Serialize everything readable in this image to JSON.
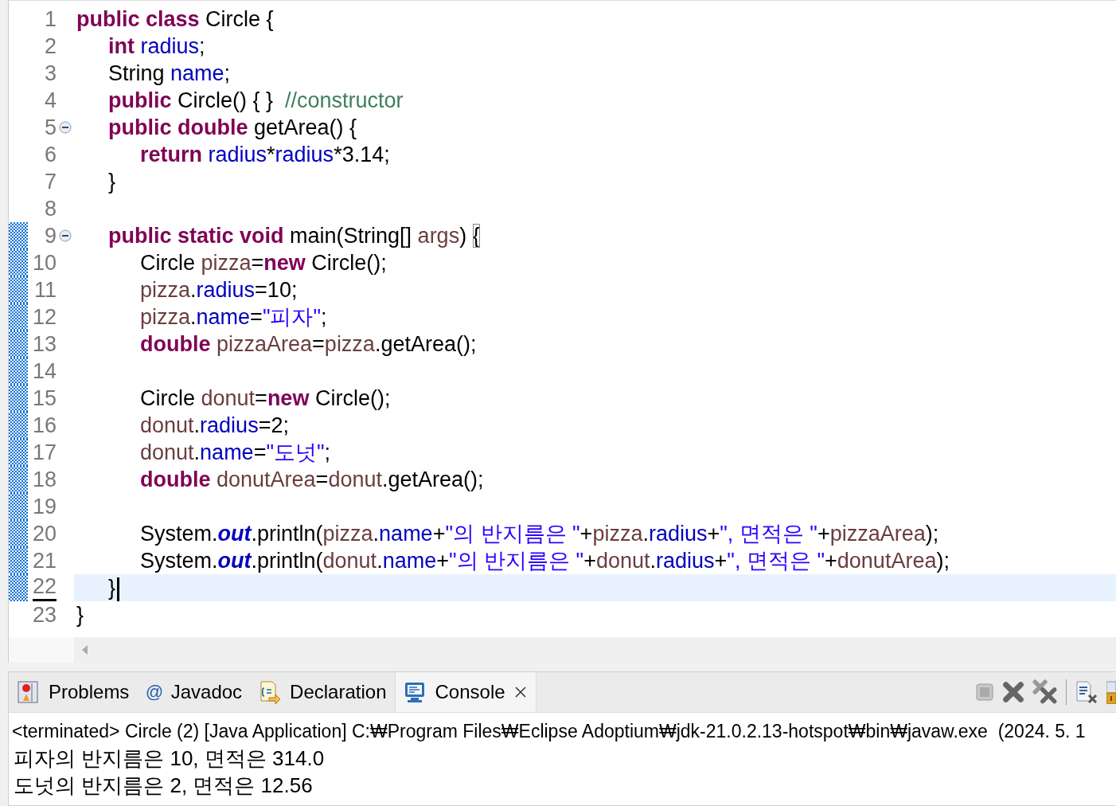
{
  "editor": {
    "lines": [
      {
        "number": "1",
        "changed": false,
        "current": false,
        "tokens": [
          {
            "kind": "kw",
            "text": "public class"
          },
          {
            "kind": "plain",
            "text": " Circle {"
          }
        ],
        "children": [
          {
            "number": "2",
            "changed": false,
            "current": false,
            "tokens": [
              {
                "kind": "kw",
                "text": "int"
              },
              {
                "kind": "field",
                "text": " radius"
              },
              {
                "kind": "plain",
                "text": ";"
              }
            ]
          },
          {
            "number": "3",
            "changed": false,
            "current": false,
            "tokens": [
              {
                "kind": "plain",
                "text": "String "
              },
              {
                "kind": "field",
                "text": "name"
              },
              {
                "kind": "plain",
                "text": ";"
              }
            ]
          },
          {
            "number": "4",
            "changed": false,
            "current": false,
            "tokens": [
              {
                "kind": "kw",
                "text": "public"
              },
              {
                "kind": "plain",
                "text": " Circle() { }  "
              },
              {
                "kind": "comment",
                "text": "//constructor"
              }
            ]
          },
          {
            "number": "5",
            "changed": false,
            "current": false,
            "collapsed": false,
            "tokens": [
              {
                "kind": "kw",
                "text": "public double"
              },
              {
                "kind": "plain",
                "text": " getArea() {"
              }
            ],
            "children": [
              {
                "number": "6",
                "changed": false,
                "current": false,
                "tokens": [
                  {
                    "kind": "kw",
                    "text": "return"
                  },
                  {
                    "kind": "field",
                    "text": " radius"
                  },
                  {
                    "kind": "plain",
                    "text": "*"
                  },
                  {
                    "kind": "field",
                    "text": "radius"
                  },
                  {
                    "kind": "plain",
                    "text": "*3.14;"
                  }
                ]
              }
            ]
          },
          {
            "number": "7",
            "changed": false,
            "current": false,
            "tokens": [
              {
                "kind": "plain",
                "text": "}"
              }
            ]
          },
          {
            "number": "8",
            "changed": false,
            "current": false
          },
          {
            "number": "9",
            "changed": true,
            "current": false,
            "collapsed": false,
            "tokens": [
              {
                "kind": "kw",
                "text": "public static void"
              },
              {
                "kind": "plain",
                "text": " main(String[] "
              },
              {
                "kind": "local",
                "text": "args"
              },
              {
                "kind": "plain",
                "text": ") "
              },
              {
                "kind": "match",
                "text": "{"
              }
            ],
            "children": [
              {
                "number": "10",
                "changed": true,
                "current": false,
                "tokens": [
                  {
                    "kind": "plain",
                    "text": "Circle "
                  },
                  {
                    "kind": "local",
                    "text": "pizza"
                  },
                  {
                    "kind": "plain",
                    "text": "="
                  },
                  {
                    "kind": "kw",
                    "text": "new"
                  },
                  {
                    "kind": "plain",
                    "text": " Circle();"
                  }
                ]
              },
              {
                "number": "11",
                "changed": true,
                "current": false,
                "tokens": [
                  {
                    "kind": "local",
                    "text": "pizza"
                  },
                  {
                    "kind": "plain",
                    "text": "."
                  },
                  {
                    "kind": "field",
                    "text": "radius"
                  },
                  {
                    "kind": "plain",
                    "text": "=10;"
                  }
                ]
              },
              {
                "number": "12",
                "changed": true,
                "current": false,
                "tokens": [
                  {
                    "kind": "local",
                    "text": "pizza"
                  },
                  {
                    "kind": "plain",
                    "text": "."
                  },
                  {
                    "kind": "field",
                    "text": "name"
                  },
                  {
                    "kind": "plain",
                    "text": "="
                  },
                  {
                    "kind": "string",
                    "text": "\"피자\""
                  },
                  {
                    "kind": "plain",
                    "text": ";"
                  }
                ]
              },
              {
                "number": "13",
                "changed": true,
                "current": false,
                "tokens": [
                  {
                    "kind": "kw",
                    "text": "double"
                  },
                  {
                    "kind": "local",
                    "text": " pizzaArea"
                  },
                  {
                    "kind": "plain",
                    "text": "="
                  },
                  {
                    "kind": "local",
                    "text": "pizza"
                  },
                  {
                    "kind": "plain",
                    "text": ".getArea();"
                  }
                ]
              },
              {
                "number": "14",
                "changed": true,
                "current": false
              },
              {
                "number": "15",
                "changed": true,
                "current": false,
                "tokens": [
                  {
                    "kind": "plain",
                    "text": "Circle "
                  },
                  {
                    "kind": "local",
                    "text": "donut"
                  },
                  {
                    "kind": "plain",
                    "text": "="
                  },
                  {
                    "kind": "kw",
                    "text": "new"
                  },
                  {
                    "kind": "plain",
                    "text": " Circle();"
                  }
                ]
              },
              {
                "number": "16",
                "changed": true,
                "current": false,
                "tokens": [
                  {
                    "kind": "local",
                    "text": "donut"
                  },
                  {
                    "kind": "plain",
                    "text": "."
                  },
                  {
                    "kind": "field",
                    "text": "radius"
                  },
                  {
                    "kind": "plain",
                    "text": "=2;"
                  }
                ]
              },
              {
                "number": "17",
                "changed": true,
                "current": false,
                "tokens": [
                  {
                    "kind": "local",
                    "text": "donut"
                  },
                  {
                    "kind": "plain",
                    "text": "."
                  },
                  {
                    "kind": "field",
                    "text": "name"
                  },
                  {
                    "kind": "plain",
                    "text": "="
                  },
                  {
                    "kind": "string",
                    "text": "\"도넛\""
                  },
                  {
                    "kind": "plain",
                    "text": ";"
                  }
                ]
              },
              {
                "number": "18",
                "changed": true,
                "current": false,
                "tokens": [
                  {
                    "kind": "kw",
                    "text": "double"
                  },
                  {
                    "kind": "local",
                    "text": " donutArea"
                  },
                  {
                    "kind": "plain",
                    "text": "="
                  },
                  {
                    "kind": "local",
                    "text": "donut"
                  },
                  {
                    "kind": "plain",
                    "text": ".getArea();"
                  }
                ]
              },
              {
                "number": "19",
                "changed": true,
                "current": false
              },
              {
                "number": "20",
                "changed": true,
                "current": false,
                "tokens": [
                  {
                    "kind": "plain",
                    "text": "System."
                  },
                  {
                    "kind": "static",
                    "text": "out"
                  },
                  {
                    "kind": "plain",
                    "text": ".println("
                  },
                  {
                    "kind": "local",
                    "text": "pizza"
                  },
                  {
                    "kind": "plain",
                    "text": "."
                  },
                  {
                    "kind": "field",
                    "text": "name"
                  },
                  {
                    "kind": "plain",
                    "text": "+"
                  },
                  {
                    "kind": "string",
                    "text": "\"의 반지름은 \""
                  },
                  {
                    "kind": "plain",
                    "text": "+"
                  },
                  {
                    "kind": "local",
                    "text": "pizza"
                  },
                  {
                    "kind": "plain",
                    "text": "."
                  },
                  {
                    "kind": "field",
                    "text": "radius"
                  },
                  {
                    "kind": "plain",
                    "text": "+"
                  },
                  {
                    "kind": "string",
                    "text": "\", 면적은 \""
                  },
                  {
                    "kind": "plain",
                    "text": "+"
                  },
                  {
                    "kind": "local",
                    "text": "pizzaArea"
                  },
                  {
                    "kind": "plain",
                    "text": ");"
                  }
                ]
              },
              {
                "number": "21",
                "changed": true,
                "current": false,
                "tokens": [
                  {
                    "kind": "plain",
                    "text": "System."
                  },
                  {
                    "kind": "static",
                    "text": "out"
                  },
                  {
                    "kind": "plain",
                    "text": ".println("
                  },
                  {
                    "kind": "local",
                    "text": "donut"
                  },
                  {
                    "kind": "plain",
                    "text": "."
                  },
                  {
                    "kind": "field",
                    "text": "name"
                  },
                  {
                    "kind": "plain",
                    "text": "+"
                  },
                  {
                    "kind": "string",
                    "text": "\"의 반지름은 \""
                  },
                  {
                    "kind": "plain",
                    "text": "+"
                  },
                  {
                    "kind": "local",
                    "text": "donut"
                  },
                  {
                    "kind": "plain",
                    "text": "."
                  },
                  {
                    "kind": "field",
                    "text": "radius"
                  },
                  {
                    "kind": "plain",
                    "text": "+"
                  },
                  {
                    "kind": "string",
                    "text": "\", 면적은 \""
                  },
                  {
                    "kind": "plain",
                    "text": "+"
                  },
                  {
                    "kind": "local",
                    "text": "donutArea"
                  },
                  {
                    "kind": "plain",
                    "text": ");"
                  }
                ]
              }
            ]
          },
          {
            "number": "22",
            "changed": true,
            "current": true,
            "tokens": [
              {
                "kind": "plain",
                "text": "}"
              }
            ]
          }
        ]
      },
      {
        "number": "23",
        "changed": false,
        "current": false,
        "tokens": [
          {
            "kind": "plain",
            "text": "}"
          }
        ]
      }
    ]
  },
  "console": {
    "tabs": [
      {
        "kind": "problems",
        "label": "Problems",
        "selected": false
      },
      {
        "kind": "javadoc",
        "glyph": "@",
        "label": "Javadoc",
        "selected": false
      },
      {
        "kind": "declaration",
        "label": "Declaration",
        "selected": false
      },
      {
        "kind": "console",
        "label": "Console",
        "selected": true
      }
    ],
    "header": "<terminated> Circle (2) [Java Application] C:₩Program Files₩Eclipse Adoptium₩jdk-21.0.2.13-hotspot₩bin₩javaw.exe  (2024. 5. 1",
    "output": [
      "피자의 반지름은 10, 면적은 314.0",
      "도넛의 반지름은 2, 면적은 12.56"
    ]
  }
}
